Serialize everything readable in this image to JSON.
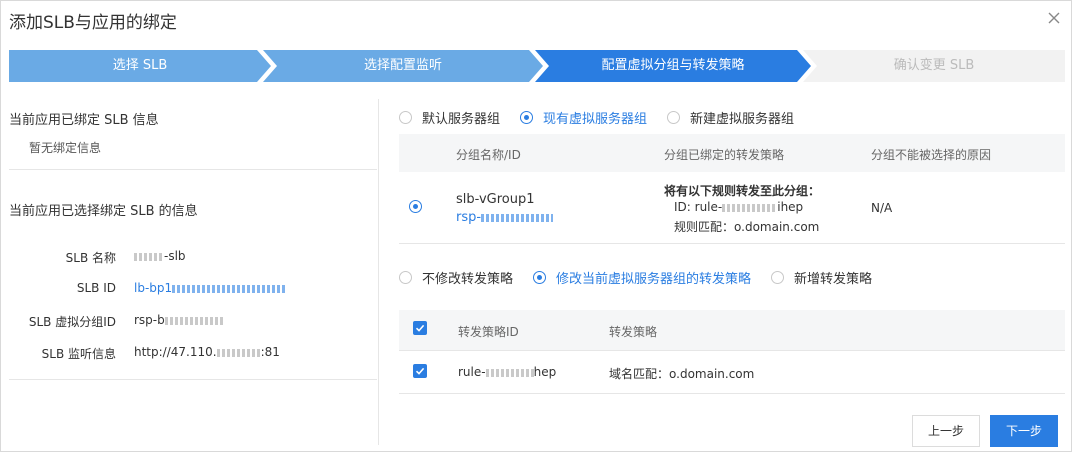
{
  "dialog": {
    "title": "添加SLB与应用的绑定"
  },
  "steps": [
    {
      "label": "选择 SLB",
      "state": "done"
    },
    {
      "label": "选择配置监听",
      "state": "done"
    },
    {
      "label": "配置虚拟分组与转发策略",
      "state": "active"
    },
    {
      "label": "确认变更 SLB",
      "state": "pending"
    }
  ],
  "left": {
    "bound_title": "当前应用已绑定 SLB 信息",
    "bound_empty": "暂无绑定信息",
    "selected_title": "当前应用已选择绑定 SLB 的信息",
    "fields": [
      {
        "label": "SLB 名称",
        "value": "-slb"
      },
      {
        "label": "SLB ID",
        "value": "lb-bp1"
      },
      {
        "label": "SLB 虚拟分组ID",
        "value": "rsp-b"
      },
      {
        "label": "SLB 监听信息",
        "value": "http://47.110.",
        "suffix": ":81"
      }
    ]
  },
  "group_radios": {
    "options": [
      "默认服务器组",
      "现有虚拟服务器组",
      "新建虚拟服务器组"
    ],
    "selected": 1
  },
  "group_table": {
    "headers": [
      "分组名称/ID",
      "分组已绑定的转发策略",
      "分组不能被选择的原因"
    ],
    "row": {
      "name": "slb-vGroup1",
      "id": "rsp-",
      "policy_title": "将有以下规则转发至此分组：",
      "policy_id_prefix": "ID: rule-",
      "policy_id_suffix": "ihep",
      "policy_match_label": "规则匹配：",
      "policy_match_value": "o.domain.com",
      "reason": "N/A"
    }
  },
  "policy_radios": {
    "options": [
      "不修改转发策略",
      "修改当前虚拟服务器组的转发策略",
      "新增转发策略"
    ],
    "selected": 1
  },
  "policy_table": {
    "headers": [
      "转发策略ID",
      "转发策略"
    ],
    "row": {
      "id_prefix": "rule-",
      "id_suffix": "hep",
      "policy": "域名匹配：o.domain.com"
    }
  },
  "footer": {
    "prev": "上一步",
    "next": "下一步"
  },
  "colors": {
    "accent": "#2a7de1",
    "step_done": "#6aaae5",
    "step_active": "#2a7de1",
    "step_pending": "#f2f2f2"
  }
}
